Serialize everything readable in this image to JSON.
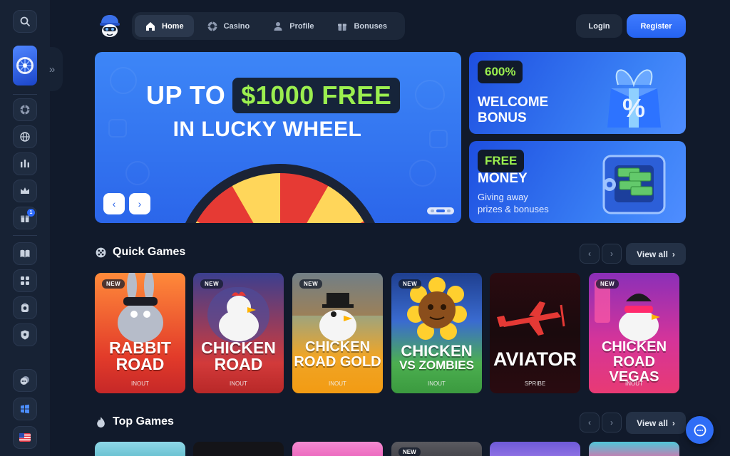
{
  "nav": {
    "items": [
      {
        "label": "Home",
        "icon": "home-icon"
      },
      {
        "label": "Casino",
        "icon": "casino-chip-icon"
      },
      {
        "label": "Profile",
        "icon": "profile-icon"
      },
      {
        "label": "Bonuses",
        "icon": "gift-icon"
      }
    ],
    "active": "Home"
  },
  "auth": {
    "login_label": "Login",
    "register_label": "Register"
  },
  "sidebar": {
    "icons": [
      "search-icon",
      "lucky-wheel-icon",
      "casino-chip-icon",
      "globe-icon",
      "sports-icon",
      "crown-icon",
      "gift-icon",
      "book-icon",
      "games-icon",
      "vip-icon",
      "shield-icon",
      "support-icon",
      "windows-icon",
      "us-flag-icon"
    ],
    "gift_badge": "1"
  },
  "hero": {
    "line1_prefix": "UP TO",
    "line1_highlight": "$1000 FREE",
    "line2": "IN LUCKY WHEEL",
    "prev_label": "‹",
    "next_label": "›"
  },
  "promos": [
    {
      "pill": "600%",
      "title1": "WELCOME",
      "title2": "BONUS"
    },
    {
      "pill": "FREE",
      "title1": "MONEY",
      "subtitle1": "Giving away",
      "subtitle2": "prizes & bonuses"
    }
  ],
  "quick_games": {
    "title": "Quick Games",
    "view_all": "View all",
    "games": [
      {
        "name1": "RABBIT",
        "name2": "ROAD",
        "provider": "INOUT",
        "badge": "NEW"
      },
      {
        "name1": "CHICKEN",
        "name2": "ROAD",
        "provider": "INOUT",
        "badge": "NEW"
      },
      {
        "name1": "CHICKEN",
        "name2": "ROAD GOLD",
        "provider": "INOUT",
        "badge": "NEW"
      },
      {
        "name1": "CHICKEN",
        "name2": "VS ZOMBIES",
        "provider": "INOUT",
        "badge": "NEW"
      },
      {
        "name1": "AVIATOR",
        "name2": "",
        "provider": "SPRIBE",
        "badge": ""
      },
      {
        "name1": "CHICKEN",
        "name2": "ROAD VEGAS",
        "provider": "INOUT",
        "badge": "NEW"
      }
    ]
  },
  "top_games": {
    "title": "Top Games",
    "view_all": "View all",
    "first_badge_index_label": "NEW"
  },
  "colors": {
    "background": "#111a2b",
    "accent_blue": "#2f6df6",
    "highlight_green": "#9bef4f"
  }
}
